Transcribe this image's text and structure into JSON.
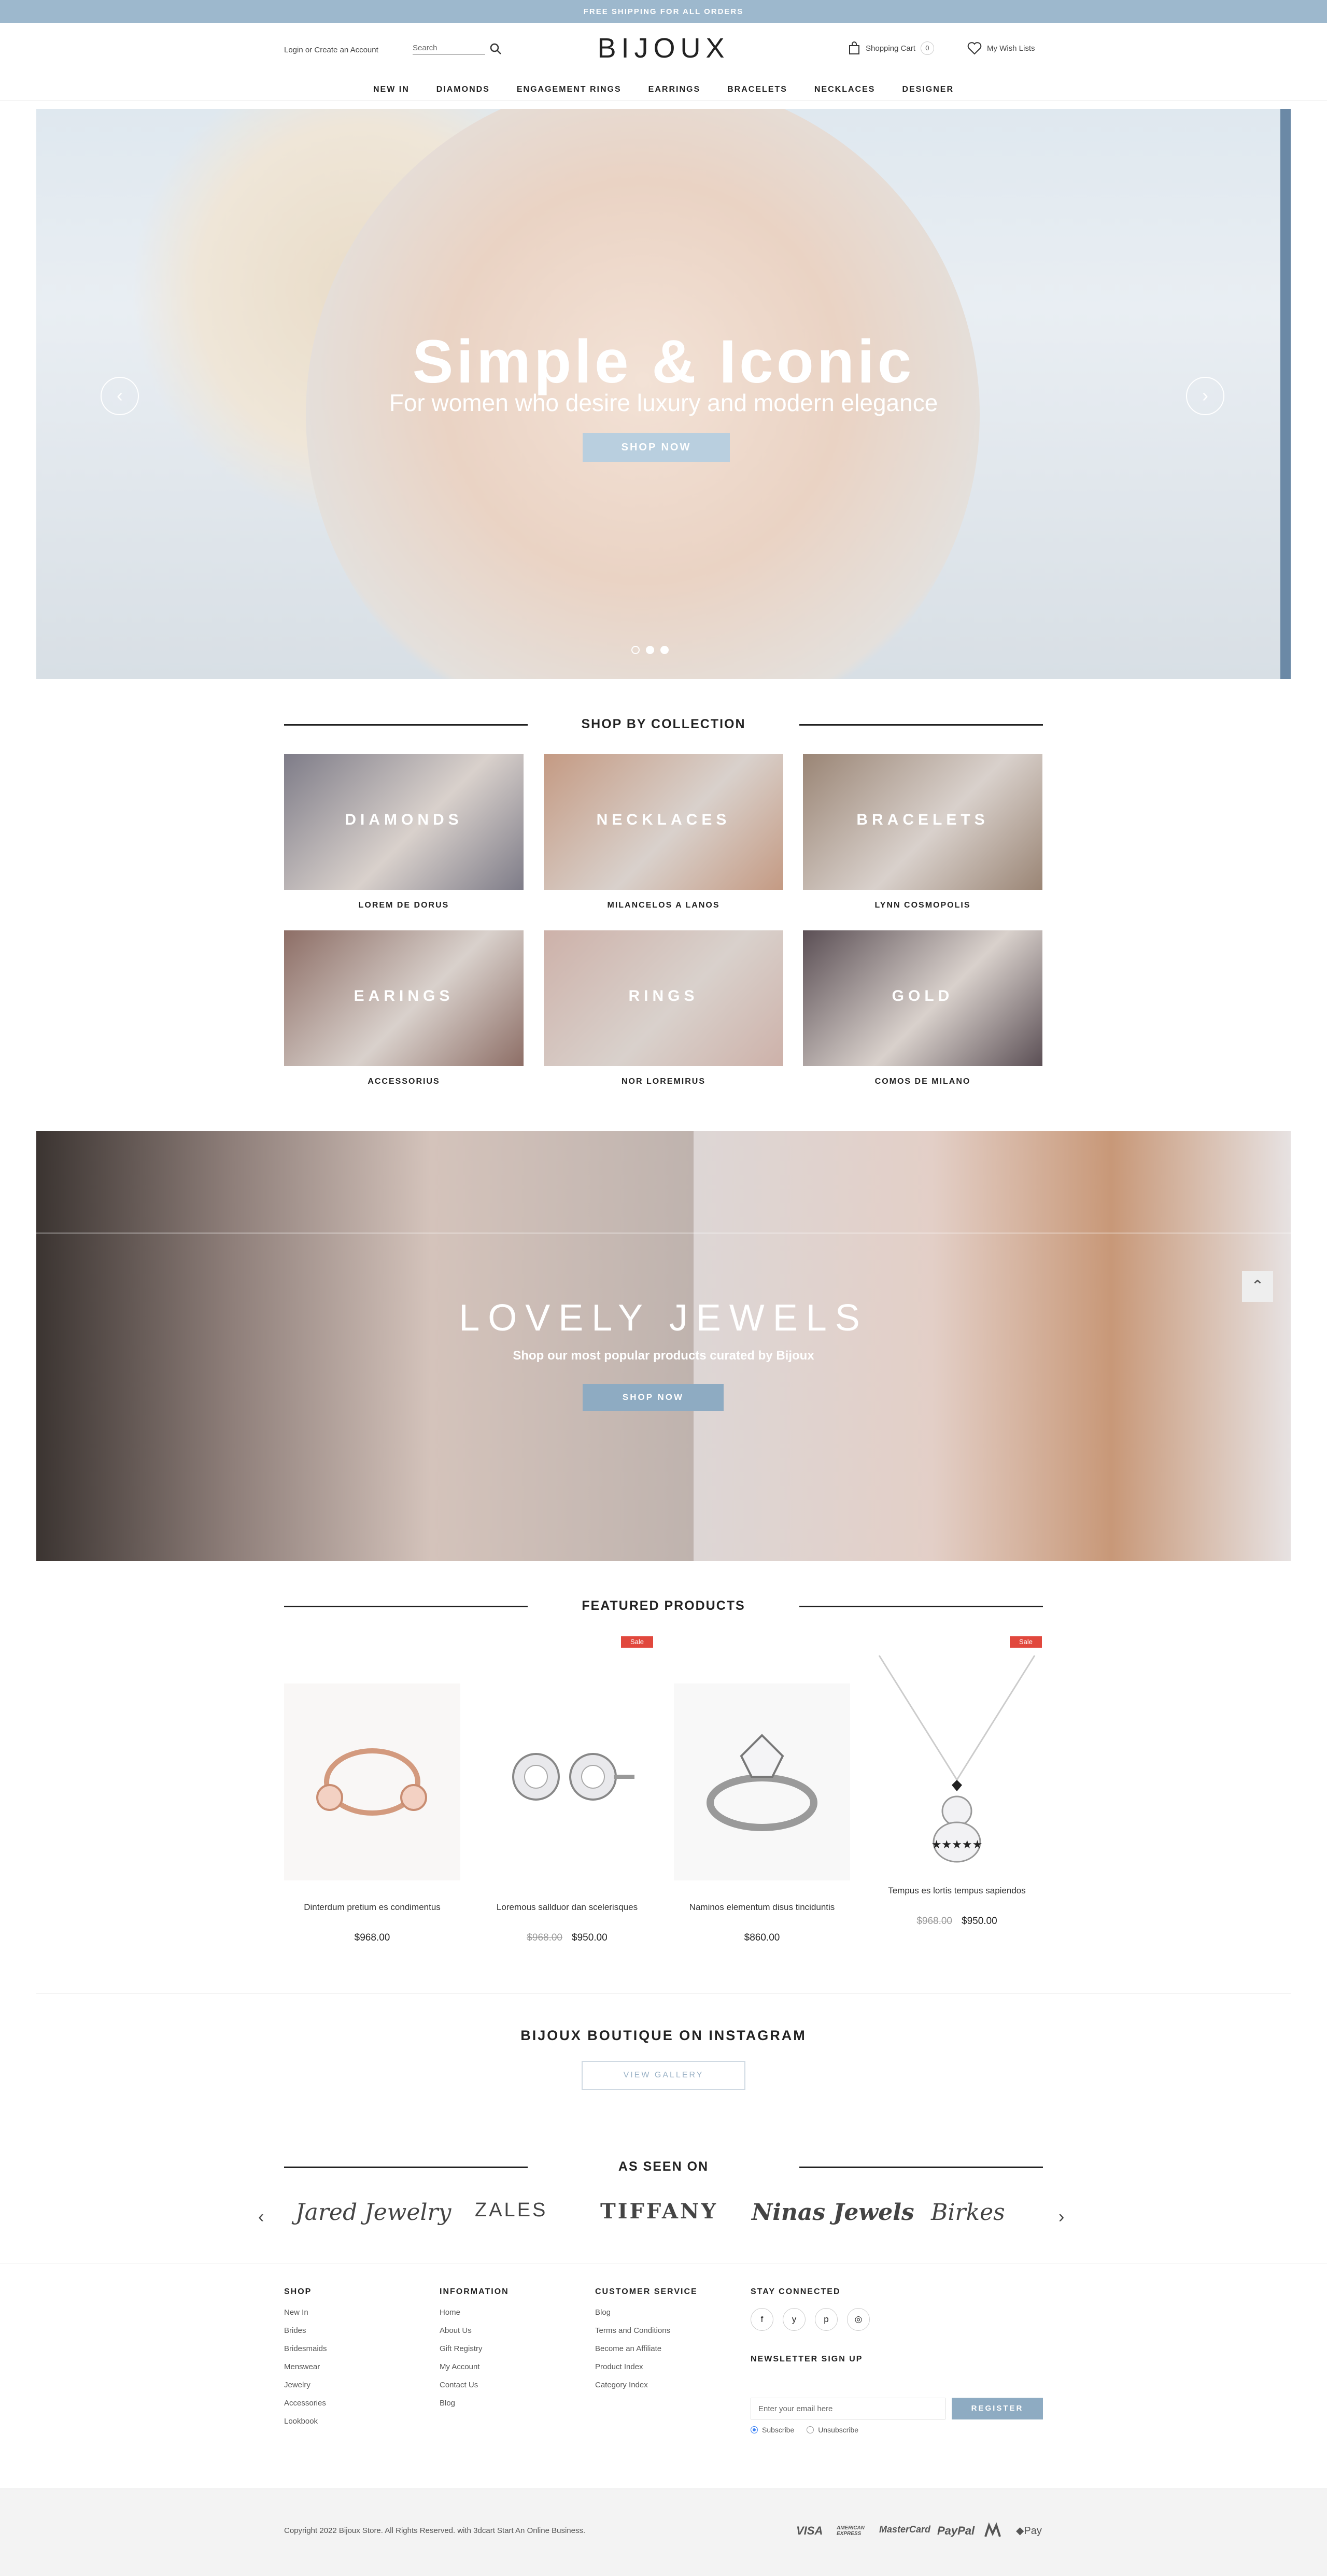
{
  "topbar": {
    "text": "FREE SHIPPING FOR ALL ORDERS"
  },
  "header": {
    "login": "Login or Create an Account",
    "search_placeholder": "Search",
    "logo": "BIJOUX",
    "cart_label": "Shopping Cart",
    "cart_count": "0",
    "wishlist_label": "My Wish Lists"
  },
  "nav": [
    "NEW IN",
    "DIAMONDS",
    "ENGAGEMENT RINGS",
    "EARRINGS",
    "BRACELETS",
    "NECKLACES",
    "DESIGNER"
  ],
  "hero": {
    "title": "Simple & Iconic",
    "subtitle": "For women who desire luxury and modern elegance",
    "button": "SHOP NOW",
    "prev": "‹",
    "next": "›"
  },
  "collection": {
    "title": "SHOP BY COLLECTION",
    "items": [
      {
        "label": "DIAMONDS",
        "caption": "LOREM DE DORUS",
        "color": "#7e7c88"
      },
      {
        "label": "NECKLACES",
        "caption": "MILANCELOS A LANOS",
        "color": "#c49a83"
      },
      {
        "label": "BRACELETS",
        "caption": "LYNN COSMOPOLIS",
        "color": "#9a8575"
      },
      {
        "label": "EARINGS",
        "caption": "ACCESSORIUS",
        "color": "#8d6e66"
      },
      {
        "label": "RINGS",
        "caption": "NOR LOREMIRUS",
        "color": "#cdb1a9"
      },
      {
        "label": "GOLD",
        "caption": "COMOS DE MILANO",
        "color": "#5b4f55"
      }
    ]
  },
  "lovely": {
    "title": "LOVELY JEWELS",
    "subtitle": "Shop our most popular products curated by Bijoux",
    "button": "SHOP NOW"
  },
  "featured": {
    "title": "FEATURED PRODUCTS",
    "sale_label": "Sale",
    "products": [
      {
        "name": "Dinterdum pretium es condimentus",
        "price": "$968.00",
        "old_price": "",
        "sale": false
      },
      {
        "name": "Loremous sallduor dan scelerisques",
        "price": "$950.00",
        "old_price": "$968.00",
        "sale": true
      },
      {
        "name": "Naminos elementum disus tinciduntis",
        "price": "$860.00",
        "old_price": "",
        "sale": false
      },
      {
        "name": "Tempus es lortis tempus sapiendos",
        "price": "$950.00",
        "old_price": "$968.00",
        "sale": true
      }
    ]
  },
  "instagram": {
    "title": "BIJOUX BOUTIQUE ON INSTAGRAM",
    "button": "VIEW GALLERY"
  },
  "seen": {
    "title": "AS SEEN ON",
    "brands": [
      "Jared Jewelry",
      "ZALES",
      "TIFFANY",
      "Ninas Jewels",
      "Birkes"
    ]
  },
  "footer": {
    "shop": {
      "title": "SHOP",
      "links": [
        "New In",
        "Brides",
        "Bridesmaids",
        "Menswear",
        "Jewelry",
        "Accessories",
        "Lookbook"
      ]
    },
    "information": {
      "title": "INFORMATION",
      "links": [
        "Home",
        "About Us",
        "Gift Registry",
        "My Account",
        "Contact Us",
        "Blog"
      ]
    },
    "service": {
      "title": "CUSTOMER SERVICE",
      "links": [
        "Blog",
        "Terms and Conditions",
        "Become an Affiliate",
        "Product Index",
        "Category Index"
      ]
    },
    "connect": {
      "title": "STAY CONNECTED",
      "social": [
        "f",
        "y",
        "p",
        "◎"
      ]
    },
    "newsletter": {
      "title": "NEWSLETTER SIGN UP",
      "placeholder": "Enter your email here",
      "button": "REGISTER",
      "subscribe": "Subscribe",
      "unsubscribe": "Unsubscribe"
    }
  },
  "bottom": {
    "copyright": "Copyright 2022 Bijoux Store. All Rights Reserved. with 3dcart Start An Online Business.",
    "payments": [
      "VISA",
      "AMERICAN EXPRESS",
      "MasterCard",
      "PayPal",
      "",
      "Pay"
    ]
  },
  "colors": {
    "accent": "#9db8cd",
    "button": "#8eabc2",
    "sale": "#e1483d"
  }
}
